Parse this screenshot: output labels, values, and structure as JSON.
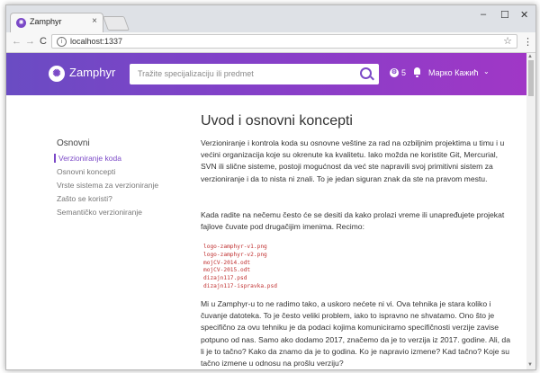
{
  "browser": {
    "tab_title": "Zamphyr",
    "tab_close": "×",
    "url": "localhost:1337",
    "controls": {
      "minimize": "–",
      "maximize": "☐",
      "close": "✕"
    },
    "nav": {
      "back": "←",
      "forward": "→",
      "reload": "C"
    },
    "star": "☆",
    "menu": "⋮"
  },
  "header": {
    "logo_text": "Zamphyr",
    "search_placeholder": "Tražite specijalizaciju ili predmet",
    "points": "5",
    "user_name": "Марко Кажић",
    "user_chevron": "⌄"
  },
  "sidebar": {
    "title": "Osnovni",
    "items": [
      "Verzioniranje koda",
      "Osnovni koncepti",
      "Vrste sistema za verzioniranje",
      "Zašto se koristi?",
      "Semantičko verzioniranje"
    ],
    "active_index": 0
  },
  "article": {
    "title": "Uvod i osnovni koncepti",
    "p1": "Verzioniranje i kontrola koda su osnovne veštine za rad na ozbiljnim projektima u timu i u većini organizacija koje su okrenute ka kvalitetu. Iako možda ne koristite Git, Mercurial, SVN ili slične sisteme, postoji mogućnost da već ste napravili svoj primitivni sistem za verzioniranje i da to nista ni znali. To je jedan siguran znak da ste na pravom mestu.",
    "p2": "Kada radite na nečemu često će se desiti da kako prolazi vreme ili unapređujete projekat fajlove čuvate pod drugačijim imenima. Recimo:",
    "code_lines": [
      "logo-zamphyr-v1.png",
      "logo-zamphyr-v2.png",
      "mojCV-2014.odt",
      "mojCV-2015.odt",
      "dizajn117.psd",
      "dizajn117-ispravka.psd"
    ],
    "p3": "Mi u Zamphyr-u to ne radimo tako, a uskoro nećete ni vi. Ova tehnika je stara koliko i čuvanje datoteka. To je često veliki problem, iako to ispravno ne shvatamo. Ono što je specifično za ovu tehniku je da podaci kojima komuniciramo specifičnosti verzije zavise potpuno od nas. Samo ako dodamo 2017, značemo da je to verzija iz 2017. godine. Ali, da li je to tačno? Kako da znamo da je to godina. Ko je napravio izmene? Kad tačno? Koje su tačno izmene u odnosu na prošlu verziju?"
  },
  "colors": {
    "accent": "#7b49c7",
    "code": "#c03030"
  }
}
